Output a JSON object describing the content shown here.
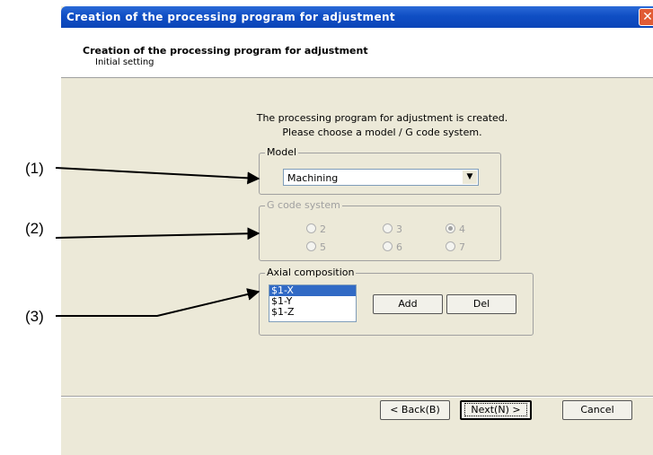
{
  "callouts": [
    "(1)",
    "(2)",
    "(3)"
  ],
  "window": {
    "title": "Creation of the processing program for adjustment",
    "close_symbol": "✕"
  },
  "header": {
    "title": "Creation of the processing program for adjustment",
    "subtitle": "Initial setting"
  },
  "intro": {
    "line1": "The processing program for adjustment is created.",
    "line2": "Please choose a model / G code system."
  },
  "model": {
    "legend": "Model",
    "value": "Machining",
    "arrow": "▼"
  },
  "gcode": {
    "legend": "G code system",
    "options": [
      {
        "label": "2",
        "checked": false
      },
      {
        "label": "3",
        "checked": false
      },
      {
        "label": "4",
        "checked": true
      },
      {
        "label": "5",
        "checked": false
      },
      {
        "label": "6",
        "checked": false
      },
      {
        "label": "7",
        "checked": false
      }
    ]
  },
  "axial": {
    "legend": "Axial composition",
    "items": [
      "$1-X",
      "$1-Y",
      "$1-Z"
    ],
    "selected_index": 0,
    "add_label": "Add",
    "del_label": "Del"
  },
  "footer": {
    "back_label": "< Back(B)",
    "next_label": "Next(N) >",
    "cancel_label": "Cancel"
  }
}
